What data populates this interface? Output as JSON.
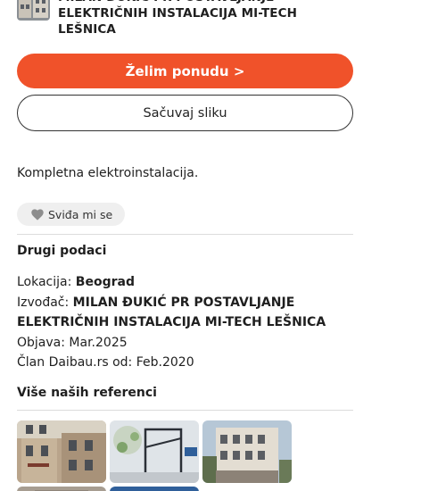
{
  "reference": {
    "contractor_title": "MILAN ĐUKIĆ PR POSTAVLJANJE ELEKTRIČNIH INSTALACIJA MI-TECH LEŠNICA",
    "description": "Kompletna elektroinstalacija."
  },
  "actions": {
    "offer_label": "Želim ponudu >",
    "save_label": "Sačuvaj sliku",
    "like_label": "Sviđa mi se"
  },
  "other_info": {
    "title": "Drugi podaci",
    "location_label": "Lokacija:",
    "location_value": "Beograd",
    "contractor_label": "Izvođač:",
    "contractor_value": "MILAN ĐUKIĆ PR POSTAVLJANJE ELEKTRIČNIH INSTALACIJA MI-TECH LEŠNICA",
    "published_label": "Objava:",
    "published_value": "Mar.2025",
    "member_label": "Član Daibau.rs od:",
    "member_value": "Feb.2020"
  },
  "more_references": {
    "title": "Više naših referenci"
  },
  "colors": {
    "accent": "#f0522a",
    "divider": "#dcdcdc",
    "chip_bg": "#efefef"
  }
}
